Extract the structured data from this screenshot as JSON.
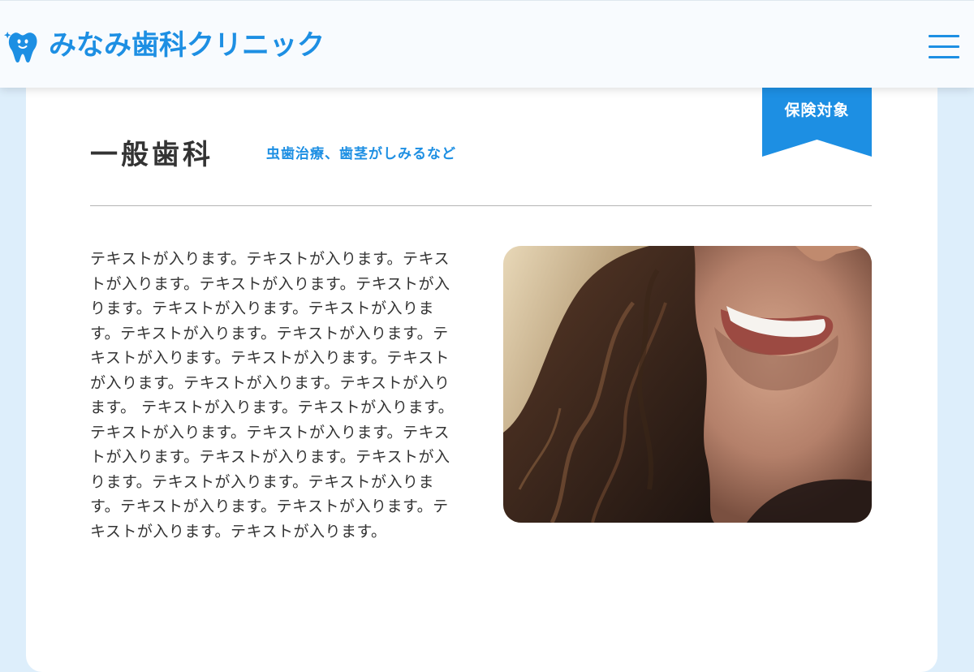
{
  "header": {
    "logo_text": "みなみ歯科クリニック",
    "logo_icon": "tooth-icon",
    "menu_icon": "hamburger-menu-icon"
  },
  "section": {
    "badge": "保険対象",
    "title": "一般歯科",
    "subtitle": "虫歯治療、歯茎がしみるなど",
    "body": "テキストが入ります。テキストが入ります。テキストが入ります。テキストが入ります。テキストが入ります。テキストが入ります。テキストが入ります。テキストが入ります。テキストが入ります。テキストが入ります。テキストが入ります。テキストが入ります。テキストが入ります。テキストが入ります。 テキストが入ります。テキストが入ります。テキストが入ります。テキストが入ります。テキストが入ります。テキストが入ります。テキストが入ります。テキストが入ります。テキストが入ります。テキストが入ります。テキストが入ります。テキストが入ります。テキストが入ります。",
    "photo_subject": "smiling-woman-photo"
  },
  "colors": {
    "accent": "#1d8fe3",
    "page_background": "#ddeefb",
    "text": "#333333"
  }
}
